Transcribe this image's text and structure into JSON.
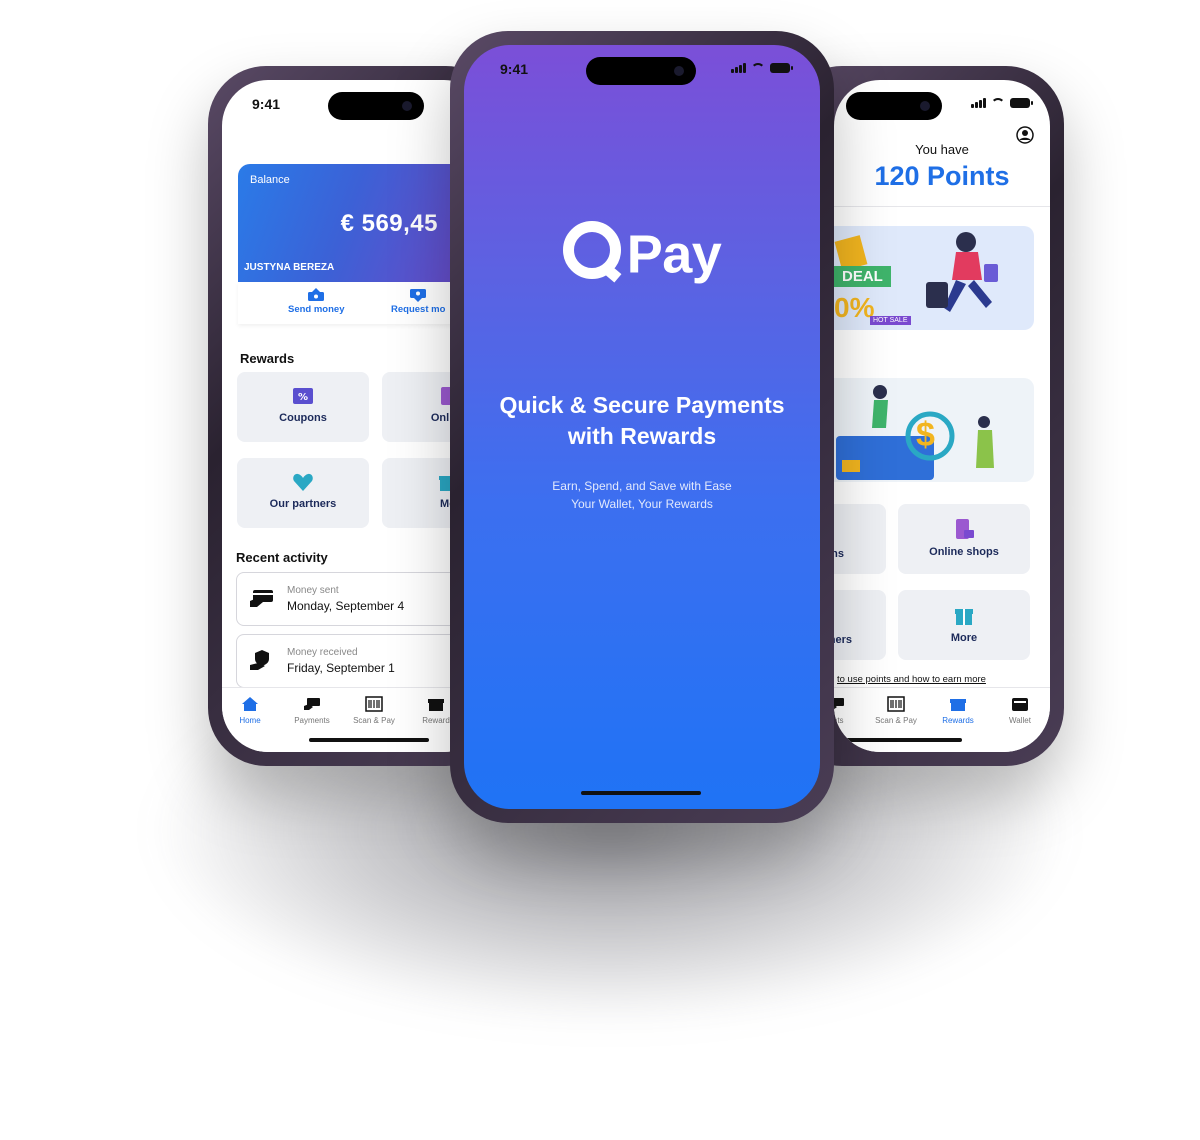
{
  "status": {
    "time": "9:41"
  },
  "left": {
    "balance_label": "Balance",
    "balance_amount": "€ 569,45",
    "card_holder": "JUSTYNA BEREZA",
    "send_money": "Send money",
    "request_money": "Request mo",
    "rewards_title": "Rewards",
    "tiles": [
      "Coupons",
      "Online",
      "Our partners",
      "Mo"
    ],
    "recent_title": "Recent activity",
    "activity": [
      {
        "sub": "Money sent",
        "main": "Monday, September 4"
      },
      {
        "sub": "Money received",
        "main": "Friday, September 1"
      }
    ],
    "tabs": [
      "Home",
      "Payments",
      "Scan & Pay",
      "Reward"
    ]
  },
  "center": {
    "logo_text": "Pay",
    "tagline_1": "Quick & Secure Payments",
    "tagline_2": "with Rewards",
    "sub_1": "Earn, Spend, and Save with Ease",
    "sub_2": "Your Wallet, Your Rewards"
  },
  "right": {
    "you_have": "You have",
    "points": "120 Points",
    "deal": "DEAL",
    "percent": "0%",
    "hot_sale": "HOT SALE",
    "dollar": "$",
    "tiles": [
      "ns",
      "Online shops",
      "ners",
      "More"
    ],
    "link": "to use points and how to earn more",
    "tabs": [
      "ents",
      "Scan & Pay",
      "Rewards",
      "Wallet"
    ]
  },
  "colors": {
    "accent": "#1f6fe6",
    "gradient_top": "#7b4fd8",
    "gradient_bottom": "#1f73f5"
  }
}
